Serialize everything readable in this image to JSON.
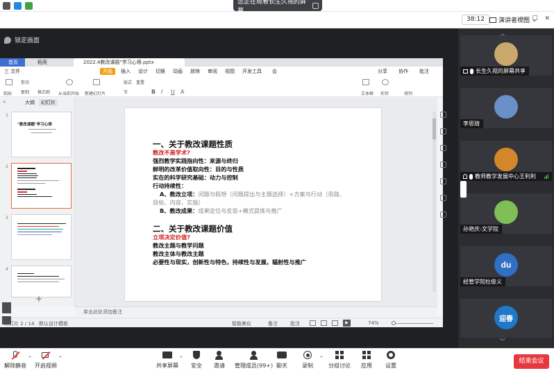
{
  "top_bar": {
    "banner_text": "您正在观看长生久视的屏幕"
  },
  "header": {
    "timer": "38:12",
    "presenter_view": "演讲者视图"
  },
  "stage": {
    "lock_label": "锁定画面"
  },
  "wps": {
    "tabs": {
      "home": "首页",
      "wps": "稻壳",
      "document": "2022.4教改课题\"学习心得.pptx"
    },
    "menu": [
      "三 文件",
      "开始",
      "插入",
      "设计",
      "切换",
      "动画",
      "放映",
      "审阅",
      "视图",
      "开发工具",
      "会"
    ],
    "menu_right": [
      "分享",
      "协作",
      "批注"
    ],
    "ribbon": [
      "粘贴",
      "剪切",
      "复制",
      "格式刷",
      "从当前开始",
      "新建幻灯片",
      "版式",
      "节",
      "重置",
      "文本框",
      "形状",
      "排列"
    ],
    "panel_tabs": [
      "大纲",
      "幻灯片"
    ],
    "thumbs": [
      "1",
      "2",
      "3",
      "4"
    ],
    "thumb1_title": "\"教改课题\"学习心得",
    "slide": {
      "h1_a": "一、关于教改课题性质",
      "red_a": "教改不是学术?",
      "l1": "强烈教学实践指向性：来源与终归",
      "l2": "鲜明的改革价值取向性：目的与性质",
      "l3": "实在的科学研究基础：动力与控制",
      "l4": "行动持续性：",
      "la_label": "A、教改立项：",
      "la_text": "问题与假想（问题提出与主题选择）+方案与行动（思路、",
      "la_cont": "目标、内容、实施）",
      "lb_label": "B、教改成果：",
      "lb_text": "成果定位与反思+模式提炼与推广",
      "h1_b": "二、关于教改课题价值",
      "red_b": "立项决定价值?",
      "m1": "教改主题与教学问题",
      "m2": "教改主体与教改主题",
      "m3": "必要性与现实，创新性与特色，持续性与发展，辐射性与推广"
    },
    "notes_placeholder": "单击此处添加备注",
    "status": {
      "slide_count": "幻灯片 2 / 14",
      "template": "默认设计模板",
      "smart_beauty": "智能美化",
      "notes_btn": "备注",
      "comment_btn": "批注",
      "zoom": "74%"
    }
  },
  "participants": [
    {
      "name": "长生久视的屏幕共享",
      "color": "#c8a96b",
      "mic": true
    },
    {
      "name": "李思琦",
      "color": "#6a8fc9",
      "mic": false
    },
    {
      "name": "教师教学发展中心王利利",
      "color": "#d4862b",
      "mic": true
    },
    {
      "name": "孙艳庆-文学院",
      "color": "#7fbf55",
      "mic": false
    },
    {
      "name": "经管学院杜俊义",
      "color": "#2f6fc4",
      "mic": false
    },
    {
      "name": "迎春",
      "color": "#1f78c8",
      "mic": false
    }
  ],
  "avatar_text": {
    "p5": "du",
    "p6": "迎春"
  },
  "toolbar": {
    "mute": "解除静音",
    "video": "开启视频",
    "share": "共享屏幕",
    "security": "安全",
    "invite": "邀请",
    "members": "管理成员(99+)",
    "chat": "聊天",
    "record": "录制",
    "breakout": "分组讨论",
    "apps": "应用",
    "settings": "设置",
    "end": "结束会议"
  }
}
